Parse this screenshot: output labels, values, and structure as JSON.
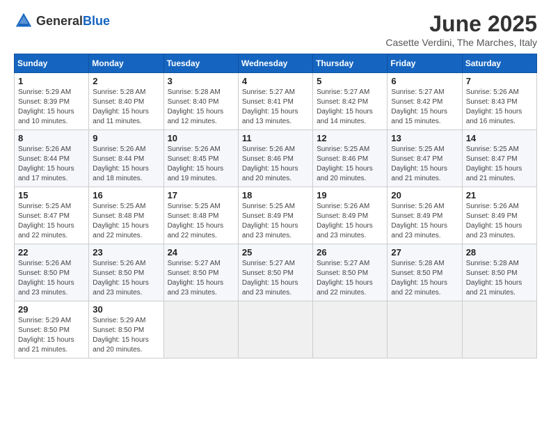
{
  "header": {
    "logo_general": "General",
    "logo_blue": "Blue",
    "month_title": "June 2025",
    "location": "Casette Verdini, The Marches, Italy"
  },
  "days_of_week": [
    "Sunday",
    "Monday",
    "Tuesday",
    "Wednesday",
    "Thursday",
    "Friday",
    "Saturday"
  ],
  "weeks": [
    [
      {
        "day": "1",
        "info": "Sunrise: 5:29 AM\nSunset: 8:39 PM\nDaylight: 15 hours\nand 10 minutes."
      },
      {
        "day": "2",
        "info": "Sunrise: 5:28 AM\nSunset: 8:40 PM\nDaylight: 15 hours\nand 11 minutes."
      },
      {
        "day": "3",
        "info": "Sunrise: 5:28 AM\nSunset: 8:40 PM\nDaylight: 15 hours\nand 12 minutes."
      },
      {
        "day": "4",
        "info": "Sunrise: 5:27 AM\nSunset: 8:41 PM\nDaylight: 15 hours\nand 13 minutes."
      },
      {
        "day": "5",
        "info": "Sunrise: 5:27 AM\nSunset: 8:42 PM\nDaylight: 15 hours\nand 14 minutes."
      },
      {
        "day": "6",
        "info": "Sunrise: 5:27 AM\nSunset: 8:42 PM\nDaylight: 15 hours\nand 15 minutes."
      },
      {
        "day": "7",
        "info": "Sunrise: 5:26 AM\nSunset: 8:43 PM\nDaylight: 15 hours\nand 16 minutes."
      }
    ],
    [
      {
        "day": "8",
        "info": "Sunrise: 5:26 AM\nSunset: 8:44 PM\nDaylight: 15 hours\nand 17 minutes."
      },
      {
        "day": "9",
        "info": "Sunrise: 5:26 AM\nSunset: 8:44 PM\nDaylight: 15 hours\nand 18 minutes."
      },
      {
        "day": "10",
        "info": "Sunrise: 5:26 AM\nSunset: 8:45 PM\nDaylight: 15 hours\nand 19 minutes."
      },
      {
        "day": "11",
        "info": "Sunrise: 5:26 AM\nSunset: 8:46 PM\nDaylight: 15 hours\nand 20 minutes."
      },
      {
        "day": "12",
        "info": "Sunrise: 5:25 AM\nSunset: 8:46 PM\nDaylight: 15 hours\nand 20 minutes."
      },
      {
        "day": "13",
        "info": "Sunrise: 5:25 AM\nSunset: 8:47 PM\nDaylight: 15 hours\nand 21 minutes."
      },
      {
        "day": "14",
        "info": "Sunrise: 5:25 AM\nSunset: 8:47 PM\nDaylight: 15 hours\nand 21 minutes."
      }
    ],
    [
      {
        "day": "15",
        "info": "Sunrise: 5:25 AM\nSunset: 8:47 PM\nDaylight: 15 hours\nand 22 minutes."
      },
      {
        "day": "16",
        "info": "Sunrise: 5:25 AM\nSunset: 8:48 PM\nDaylight: 15 hours\nand 22 minutes."
      },
      {
        "day": "17",
        "info": "Sunrise: 5:25 AM\nSunset: 8:48 PM\nDaylight: 15 hours\nand 22 minutes."
      },
      {
        "day": "18",
        "info": "Sunrise: 5:25 AM\nSunset: 8:49 PM\nDaylight: 15 hours\nand 23 minutes."
      },
      {
        "day": "19",
        "info": "Sunrise: 5:26 AM\nSunset: 8:49 PM\nDaylight: 15 hours\nand 23 minutes."
      },
      {
        "day": "20",
        "info": "Sunrise: 5:26 AM\nSunset: 8:49 PM\nDaylight: 15 hours\nand 23 minutes."
      },
      {
        "day": "21",
        "info": "Sunrise: 5:26 AM\nSunset: 8:49 PM\nDaylight: 15 hours\nand 23 minutes."
      }
    ],
    [
      {
        "day": "22",
        "info": "Sunrise: 5:26 AM\nSunset: 8:50 PM\nDaylight: 15 hours\nand 23 minutes."
      },
      {
        "day": "23",
        "info": "Sunrise: 5:26 AM\nSunset: 8:50 PM\nDaylight: 15 hours\nand 23 minutes."
      },
      {
        "day": "24",
        "info": "Sunrise: 5:27 AM\nSunset: 8:50 PM\nDaylight: 15 hours\nand 23 minutes."
      },
      {
        "day": "25",
        "info": "Sunrise: 5:27 AM\nSunset: 8:50 PM\nDaylight: 15 hours\nand 23 minutes."
      },
      {
        "day": "26",
        "info": "Sunrise: 5:27 AM\nSunset: 8:50 PM\nDaylight: 15 hours\nand 22 minutes."
      },
      {
        "day": "27",
        "info": "Sunrise: 5:28 AM\nSunset: 8:50 PM\nDaylight: 15 hours\nand 22 minutes."
      },
      {
        "day": "28",
        "info": "Sunrise: 5:28 AM\nSunset: 8:50 PM\nDaylight: 15 hours\nand 21 minutes."
      }
    ],
    [
      {
        "day": "29",
        "info": "Sunrise: 5:29 AM\nSunset: 8:50 PM\nDaylight: 15 hours\nand 21 minutes."
      },
      {
        "day": "30",
        "info": "Sunrise: 5:29 AM\nSunset: 8:50 PM\nDaylight: 15 hours\nand 20 minutes."
      },
      {
        "day": "",
        "info": ""
      },
      {
        "day": "",
        "info": ""
      },
      {
        "day": "",
        "info": ""
      },
      {
        "day": "",
        "info": ""
      },
      {
        "day": "",
        "info": ""
      }
    ]
  ]
}
